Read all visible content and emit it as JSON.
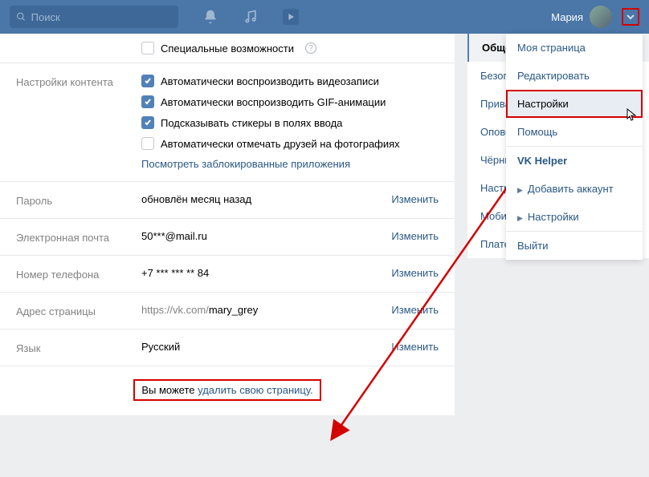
{
  "header": {
    "search_placeholder": "Поиск",
    "user_name": "Мария"
  },
  "special": {
    "label": "Специальные возможности"
  },
  "content_settings": {
    "label": "Настройки контента",
    "autoplay_video": "Автоматически воспроизводить видеозаписи",
    "autoplay_gif": "Автоматически воспроизводить GIF-анимации",
    "suggest_stickers": "Подсказывать стикеры в полях ввода",
    "auto_tag": "Автоматически отмечать друзей на фотографиях",
    "blocked_apps": "Посмотреть заблокированные приложения"
  },
  "password": {
    "label": "Пароль",
    "value": "обновлён месяц назад",
    "change": "Изменить"
  },
  "email": {
    "label": "Электронная почта",
    "value": "50***@mail.ru",
    "change": "Изменить"
  },
  "phone": {
    "label": "Номер телефона",
    "value": "+7 *** *** ** 84",
    "change": "Изменить"
  },
  "page_addr": {
    "label": "Адрес страницы",
    "value": "https://vk.com/",
    "slug": "mary_grey",
    "change": "Изменить"
  },
  "lang": {
    "label": "Язык",
    "value": "Русский",
    "change": "Изменить"
  },
  "footer": {
    "prefix": "Вы можете ",
    "link": "удалить свою страницу."
  },
  "sidebar": {
    "items": [
      "Общее",
      "Безопасность",
      "Приватность",
      "Оповещения",
      "Чёрный список",
      "Настройки приложений",
      "Мобильные сервисы",
      "Платежи и переводы"
    ]
  },
  "dropdown": {
    "my_page": "Моя страница",
    "edit": "Редактировать",
    "settings": "Настройки",
    "help": "Помощь",
    "helper_head": "VK Helper",
    "add_acc": "Добавить аккаунт",
    "helper_settings": "Настройки",
    "logout": "Выйти"
  }
}
